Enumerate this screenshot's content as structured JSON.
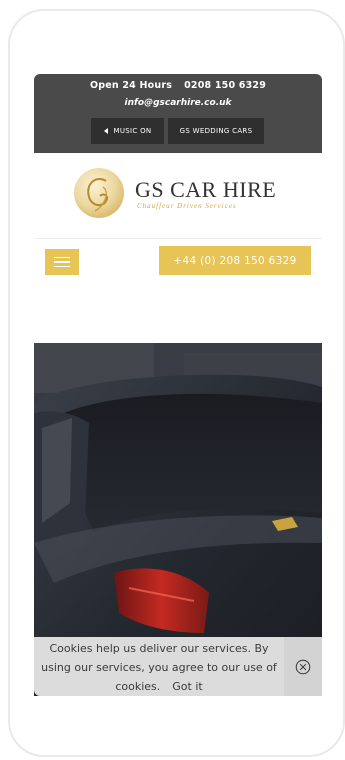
{
  "topbar": {
    "hours": "Open 24 Hours",
    "phone": "0208 150 6329",
    "email": "info@gscarhire.co.uk",
    "music_button": "MUSIC ON",
    "wedding_button": "GS WEDDING CARS"
  },
  "logo": {
    "title": "GS CAR HIRE",
    "tagline": "Chauffeur Driven Services",
    "monogram": "G"
  },
  "nav": {
    "phone_button": "+44 (0) 208 150 6329"
  },
  "cookie": {
    "message": "Cookies help us deliver our services. By using our services, you agree to our use of cookies.",
    "got_it": "Got it"
  },
  "colors": {
    "accent_gold": "#e6c455",
    "topbar_bg": "#4a4a4a",
    "cookie_bg": "#dcdcdc"
  },
  "icons": [
    "speaker-icon",
    "menu-icon",
    "close-icon"
  ]
}
